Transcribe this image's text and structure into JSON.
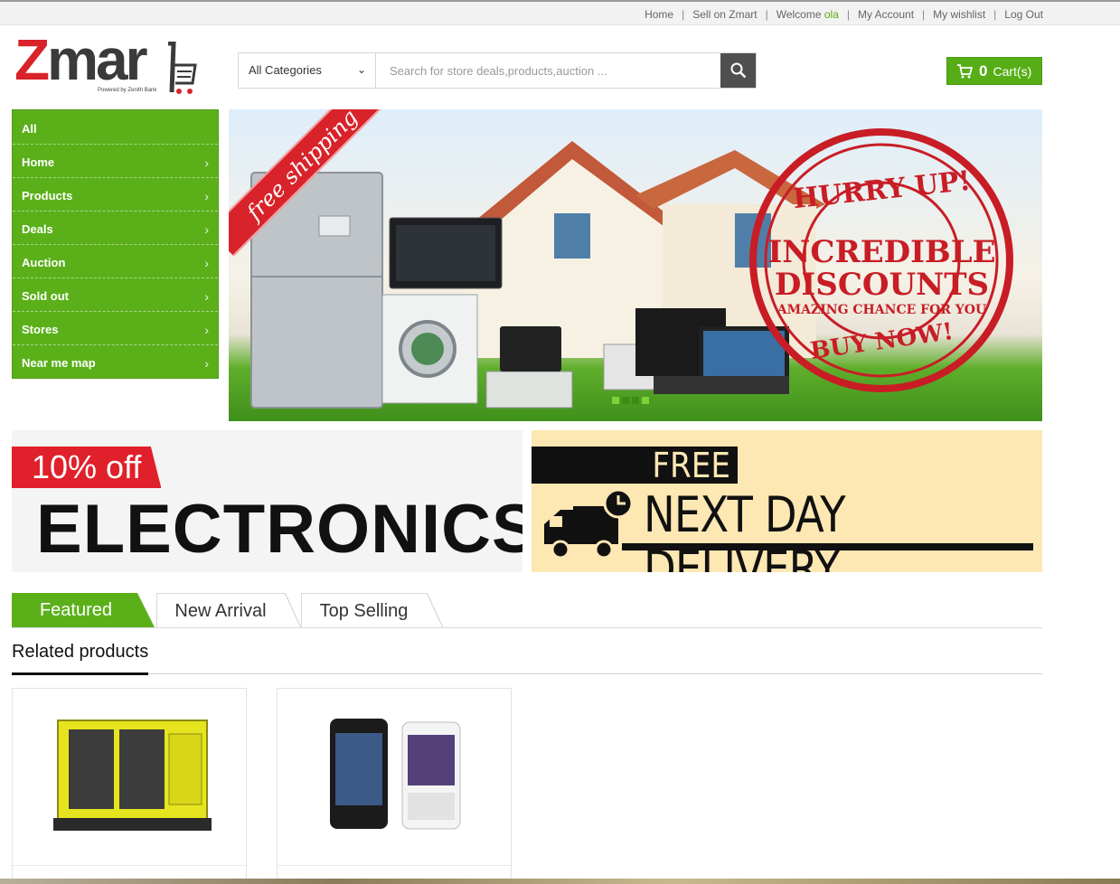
{
  "topbar": {
    "home": "Home",
    "sell": "Sell on Zmart",
    "welcome": "Welcome",
    "username": "ola",
    "account": "My Account",
    "wishlist": "My wishlist",
    "logout": "Log Out"
  },
  "logo": {
    "brand_first": "Z",
    "brand_rest": "mar",
    "tagline": "Powered by Zenith Bank"
  },
  "search": {
    "category": "All Categories",
    "placeholder": "Search for store deals,products,auction ..."
  },
  "cart": {
    "count": "0",
    "label": "Cart(s)"
  },
  "sidebar": {
    "items": [
      {
        "label": "All"
      },
      {
        "label": "Home"
      },
      {
        "label": "Products"
      },
      {
        "label": "Deals"
      },
      {
        "label": "Auction"
      },
      {
        "label": "Sold out"
      },
      {
        "label": "Stores"
      },
      {
        "label": "Near me map"
      }
    ]
  },
  "hero": {
    "ribbon": "free shipping",
    "stamp_top": "HURRY UP!",
    "stamp_line1": "INCREDIBLE",
    "stamp_line2": "DISCOUNTS",
    "stamp_sub": "AMAZING CHANCE FOR YOU",
    "stamp_bottom": "BUY NOW!"
  },
  "promos": {
    "left_badge": "10% off",
    "left_title": "ELECTRONICS",
    "right_free": "FREE",
    "right_title": "NEXT DAY DELIVERY"
  },
  "tabs": [
    {
      "label": "Featured"
    },
    {
      "label": "New Arrival"
    },
    {
      "label": "Top Selling"
    }
  ],
  "section": {
    "related": "Related products"
  },
  "colors": {
    "accent_green": "#5bb01a",
    "brand_red": "#d8232a",
    "promo_yellow": "#fde7b3"
  }
}
